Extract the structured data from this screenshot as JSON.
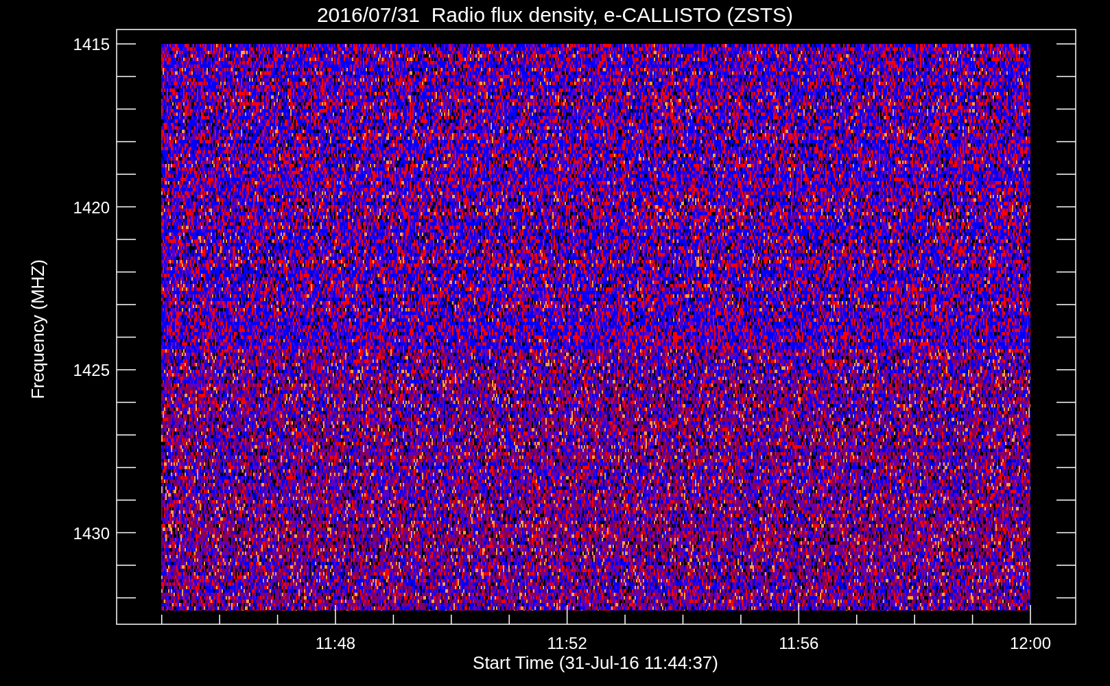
{
  "title": "2016/07/31  Radio flux density, e-CALLISTO (ZSTS)",
  "plot": {
    "y_label": "Frequency (MHZ)",
    "y_ticks": [
      "1415",
      "1420",
      "1425",
      "1430"
    ],
    "x_label": "Start Time (31-Jul-16 11:44:37)",
    "x_ticks": [
      "11:48",
      "11:52",
      "11:56",
      "12:00"
    ]
  }
}
